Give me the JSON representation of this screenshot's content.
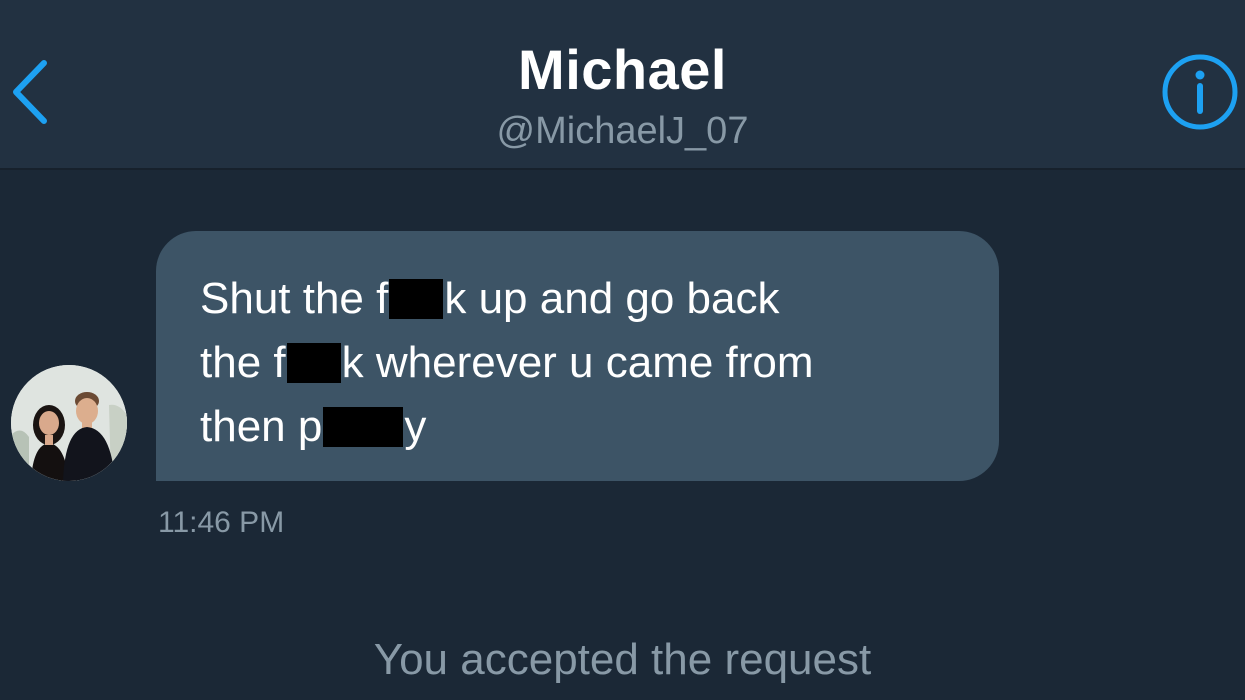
{
  "header": {
    "name": "Michael",
    "handle": "@MichaelJ_07",
    "back_icon": "chevron-left-icon",
    "info_icon": "info-icon",
    "accent_color": "#1da1f2"
  },
  "conversation": {
    "avatar_icon": "user-avatar-photo",
    "message": {
      "line1_a": "Shut the f",
      "line1_b": "k up and go back",
      "line2_a": "the f",
      "line2_b": "k wherever u came from",
      "line3_a": "then p",
      "line3_b": "y"
    },
    "timestamp": "11:46 PM",
    "notice": "You accepted the request"
  }
}
